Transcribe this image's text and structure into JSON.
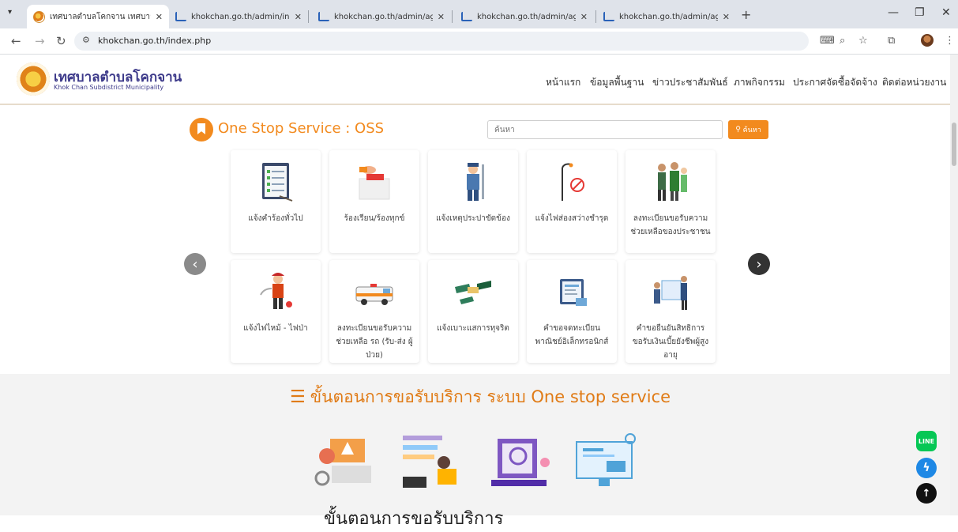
{
  "browser": {
    "tabs": [
      {
        "title": "เทศบาลตำบลโคกจาน เทศบาลตำบลโคกจาน",
        "active": true
      },
      {
        "title": "khokchan.go.th/admin/index.php",
        "active": false
      },
      {
        "title": "khokchan.go.th/admin/agency_",
        "active": false
      },
      {
        "title": "khokchan.go.th/admin/agency_",
        "active": false
      },
      {
        "title": "khokchan.go.th/admin/agency_",
        "active": false
      }
    ],
    "url": "khokchan.go.th/index.php"
  },
  "site": {
    "title": "เทศบาลตำบลโคกจาน",
    "subtitle": "Khok Chan Subdistrict Municipality",
    "menu": [
      "หน้าแรก",
      "ข้อมูลพื้นฐาน",
      "ข่าวประชาสัมพันธ์",
      "ภาพกิจกรรม",
      "ประกาศจัดซื้อจัดจ้าง",
      "ติดต่อหน่วยงาน"
    ]
  },
  "oss": {
    "title": "One Stop Service : OSS",
    "search_placeholder": "ค้นหา",
    "search_button": "ค้นหา"
  },
  "services_row1": [
    {
      "label": "แจ้งคำร้องทั่วไป",
      "icon": "clipboard-icon"
    },
    {
      "label": "ร้องเรียน/ร้องทุกข์",
      "icon": "complaint-box-icon"
    },
    {
      "label": "แจ้งเหตุประปาขัดข้อง",
      "icon": "plumber-icon"
    },
    {
      "label": "แจ้งไฟส่องสว่างชำรุด",
      "icon": "streetlight-icon"
    },
    {
      "label": "ลงทะเบียนขอรับความช่วยเหลือของประชาชน",
      "icon": "family-icon"
    }
  ],
  "services_row2": [
    {
      "label": "แจ้งไฟไหม้ - ไฟป่า",
      "icon": "firefighter-icon"
    },
    {
      "label": "ลงทะเบียนขอรับความช่วยเหลือ รถ (รับ-ส่ง ผู้ป่วย)",
      "icon": "ambulance-icon"
    },
    {
      "label": "แจ้งเบาะแสการทุจริต",
      "icon": "bribery-icon"
    },
    {
      "label": "คำขอจดทะเบียนพาณิชย์อิเล็กทรอนิกส์",
      "icon": "e-commerce-icon"
    },
    {
      "label": "คำขอยืนยันสิทธิการขอรับเงินเบี้ยยังชีพผู้สูงอายุ",
      "icon": "elderly-allowance-icon"
    }
  ],
  "steps": {
    "title": "ขั้นตอนการขอรับบริการ ระบบ One stop service",
    "bottom_partial": "ขั้นตอนการขอรับบริการ"
  },
  "floating": {
    "line_label": "LINE"
  },
  "colors": {
    "accent": "#f28a1e",
    "brand": "#3d3a8a"
  }
}
